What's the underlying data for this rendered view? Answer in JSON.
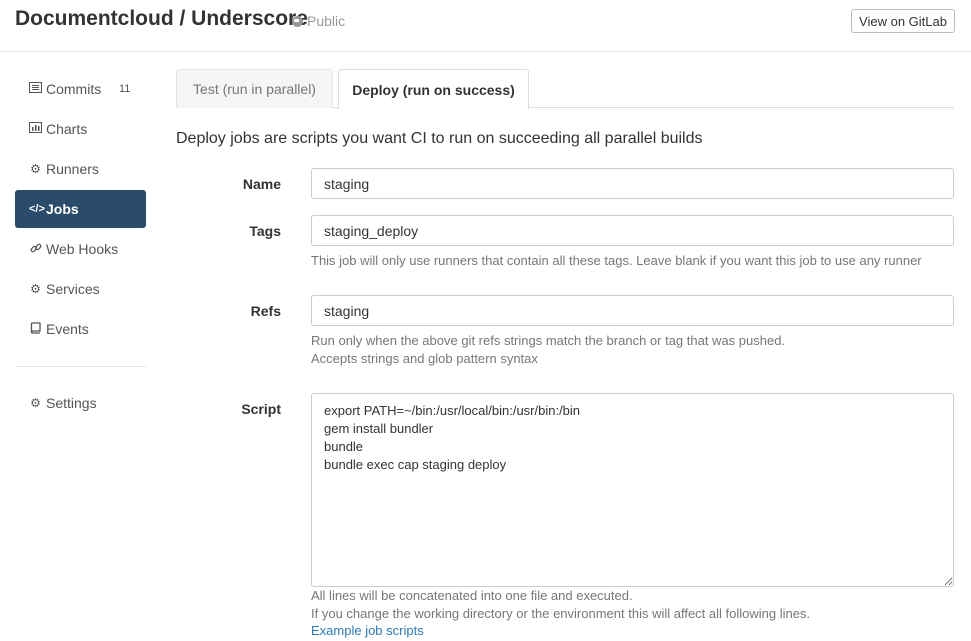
{
  "header": {
    "title": "Documentcloud / Underscore",
    "visibility": "Public",
    "view_button": "View on GitLab"
  },
  "sidebar": {
    "items": [
      {
        "label": "Commits",
        "icon": "list-icon",
        "count": "11"
      },
      {
        "label": "Charts",
        "icon": "bar-chart-icon"
      },
      {
        "label": "Runners",
        "icon": "gear-icon"
      },
      {
        "label": "Jobs",
        "icon": "code-icon",
        "active": true
      },
      {
        "label": "Web Hooks",
        "icon": "link-icon"
      },
      {
        "label": "Services",
        "icon": "gear-icon"
      },
      {
        "label": "Events",
        "icon": "book-icon"
      }
    ],
    "settings": {
      "label": "Settings",
      "icon": "gears-icon"
    }
  },
  "tabs": [
    {
      "label": "Test (run in parallel)",
      "active": false
    },
    {
      "label": "Deploy (run on success)",
      "active": true
    }
  ],
  "lead": "Deploy jobs are scripts you want CI to run on succeeding all parallel builds",
  "form": {
    "name": {
      "label": "Name",
      "value": "staging"
    },
    "tags": {
      "label": "Tags",
      "value": "staging_deploy",
      "help": "This job will only use runners that contain all these tags. Leave blank if you want this job to use any runner"
    },
    "refs": {
      "label": "Refs",
      "value": "staging",
      "help1": "Run only when the above git refs strings match the branch or tag that was pushed.",
      "help2": "Accepts strings and glob pattern syntax"
    },
    "script": {
      "label": "Script",
      "value": "export PATH=~/bin:/usr/local/bin:/usr/bin:/bin\ngem install bundler\nbundle\nbundle exec cap staging deploy",
      "help1": "All lines will be concatenated into one file and executed.",
      "help2": "If you change the working directory or the environment this will affect all following lines.",
      "link": "Example job scripts"
    }
  },
  "colors": {
    "active_nav": "#2b4b6b",
    "link": "#2e7bb6"
  }
}
